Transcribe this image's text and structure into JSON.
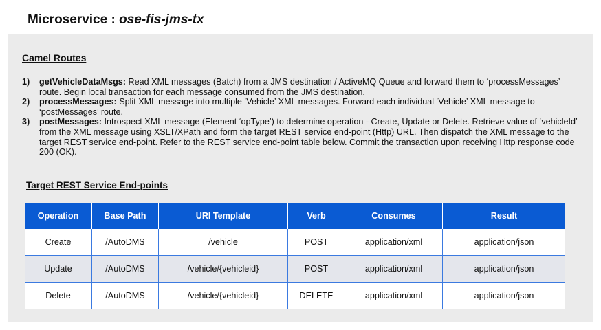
{
  "title": {
    "prefix": "Microservice : ",
    "service": "ose-fis-jms-tx"
  },
  "camel_routes": {
    "heading": "Camel Routes",
    "items": [
      {
        "num": "1)",
        "name": "getVehicleDataMsgs:",
        "text": " Read XML messages (Batch) from a JMS destination / ActiveMQ Queue and forward them to ‘processMessages’ route.  Begin local transaction for each message consumed from the JMS destination."
      },
      {
        "num": "2)",
        "name": "processMessages:",
        "text": " Split XML message into multiple ‘Vehicle’ XML messages.  Forward each individual ‘Vehicle’ XML message to ‘postMessages’ route."
      },
      {
        "num": "3)",
        "name": "postMessages:",
        "text": " Introspect XML message (Element ‘opType’) to determine operation - Create, Update or Delete.  Retrieve value of ‘vehicleId’ from the XML message using XSLT/XPath and form the target REST service end-point (Http) URL.   Then dispatch the XML message to the target REST service end-point.  Refer to the REST service end-point table below.  Commit the transaction upon receiving Http response code 200 (OK)."
      }
    ]
  },
  "rest_endpoints": {
    "heading": "Target REST Service End-points",
    "columns": [
      "Operation",
      "Base Path",
      "URI Template",
      "Verb",
      "Consumes",
      "Result"
    ],
    "rows": [
      [
        "Create",
        "/AutoDMS",
        "/vehicle",
        "POST",
        "application/xml",
        "application/json"
      ],
      [
        "Update",
        "/AutoDMS",
        "/vehicle/{vehicleid}",
        "POST",
        "application/xml",
        "application/json"
      ],
      [
        "Delete",
        "/AutoDMS",
        "/vehicle/{vehicleid}",
        "DELETE",
        "application/xml",
        "application/json"
      ]
    ]
  },
  "colors": {
    "header_bg": "#0a5bd3",
    "panel_bg": "#ebebeb",
    "alt_row_bg": "#e4e6ec"
  }
}
